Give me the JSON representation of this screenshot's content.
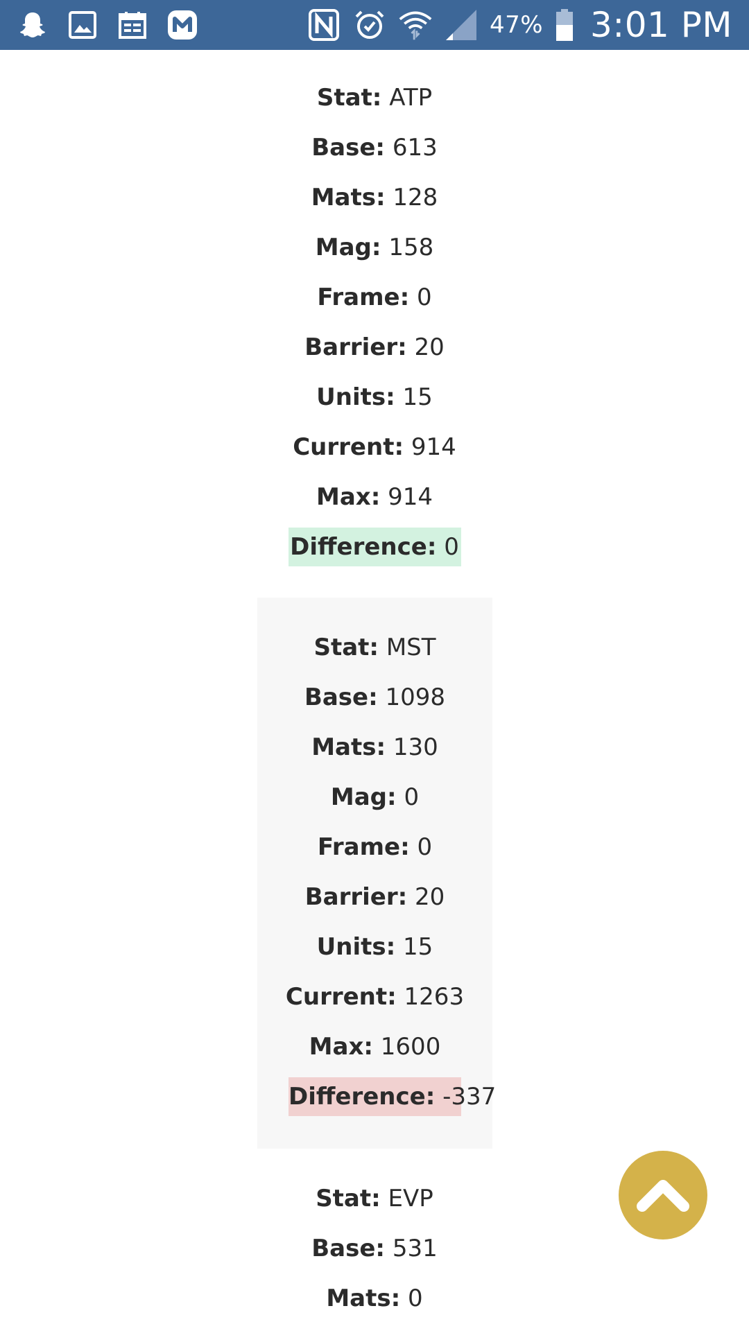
{
  "status_bar": {
    "left_icons": [
      "snapchat-icon",
      "gallery-icon",
      "calendar-icon",
      "m-app-icon"
    ],
    "right_icons": [
      "nfc-icon",
      "alarm-icon",
      "wifi-icon",
      "signal-icon",
      "battery-icon"
    ],
    "battery_percent": "47%",
    "time": "3:01 PM",
    "background_color": "#3d6798"
  },
  "stats": [
    {
      "rows": [
        {
          "label": "Stat:",
          "value": "ATP"
        },
        {
          "label": "Base:",
          "value": "613"
        },
        {
          "label": "Mats:",
          "value": "128"
        },
        {
          "label": "Mag:",
          "value": "158"
        },
        {
          "label": "Frame:",
          "value": "0"
        },
        {
          "label": "Barrier:",
          "value": "20"
        },
        {
          "label": "Units:",
          "value": "15"
        },
        {
          "label": "Current:",
          "value": "914"
        },
        {
          "label": "Max:",
          "value": "914"
        }
      ],
      "difference": {
        "label": "Difference:",
        "value": "0",
        "color": "#d3f2e0"
      }
    },
    {
      "rows": [
        {
          "label": "Stat:",
          "value": "MST"
        },
        {
          "label": "Base:",
          "value": "1098"
        },
        {
          "label": "Mats:",
          "value": "130"
        },
        {
          "label": "Mag:",
          "value": "0"
        },
        {
          "label": "Frame:",
          "value": "0"
        },
        {
          "label": "Barrier:",
          "value": "20"
        },
        {
          "label": "Units:",
          "value": "15"
        },
        {
          "label": "Current:",
          "value": "1263"
        },
        {
          "label": "Max:",
          "value": "1600"
        }
      ],
      "difference": {
        "label": "Difference:",
        "value": "-337",
        "color": "#f1d1d0"
      }
    },
    {
      "rows": [
        {
          "label": "Stat:",
          "value": "EVP"
        },
        {
          "label": "Base:",
          "value": "531"
        },
        {
          "label": "Mats:",
          "value": "0"
        }
      ]
    }
  ],
  "scroll_top_button": {
    "icon": "chevron-up-icon",
    "color": "#d4b24a"
  }
}
